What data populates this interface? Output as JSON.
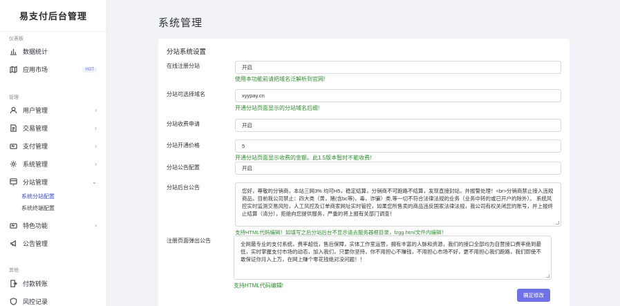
{
  "app": {
    "title": "易支付后台管理"
  },
  "sidebar": {
    "groups": [
      {
        "label": "仪表板"
      },
      {
        "label": "管理"
      },
      {
        "label": "其他"
      }
    ],
    "items": [
      {
        "label": "数据统计",
        "icon": "bar-chart-icon"
      },
      {
        "label": "应用市场",
        "icon": "map-icon",
        "badge": "HOT"
      },
      {
        "label": "用户管理",
        "icon": "user-icon"
      },
      {
        "label": "交易管理",
        "icon": "document-icon"
      },
      {
        "label": "支付管理",
        "icon": "payment-icon"
      },
      {
        "label": "系统管理",
        "icon": "gear-icon"
      },
      {
        "label": "分站管理",
        "icon": "substation-icon"
      },
      {
        "label": "特色功能",
        "icon": "feature-icon"
      },
      {
        "label": "公告管理",
        "icon": "megaphone-icon"
      },
      {
        "label": "付款转账",
        "icon": "transfer-icon"
      },
      {
        "label": "风控记录",
        "icon": "shield-icon"
      }
    ],
    "submenu": [
      {
        "label": "系统分站配置"
      },
      {
        "label": "系统终端配置"
      }
    ],
    "chevron": "›",
    "chevron_open": "⌄"
  },
  "page": {
    "title": "系统管理",
    "card_title": "分站系统设置",
    "rows": [
      {
        "label": "在线注册分站",
        "value": "开启",
        "hint": "使用本功能前请把域名泛解析到官网!"
      },
      {
        "label": "分站可选择域名",
        "value": "xyypay.cn",
        "hint": "开通分站页面显示的分站域名后缀!"
      },
      {
        "label": "分站收费申请",
        "value": "开启"
      },
      {
        "label": "分站开通价格",
        "value": "5",
        "hint": "开通分站页面显示收费的金额。此1.5版本暂时不能收费!"
      },
      {
        "label": "分站公告配置",
        "value": "开启"
      },
      {
        "label": "分站后台公告",
        "value": "您好，尊敬的分销商，本站三网3% 均可H5，稳定结算，分销商不可跑路不结算，发现直接封站，并报警处理！<br>分销商禁止接入违规商品，目前我公司禁止：四大类（黄，赌(含bc等)，毒，诈骗）类,等一切不符合法律法规的业务（业务中转的或已开户的除外）。 系统风控实时监测交易风险，人工风控及订单商家网址实时管控，如果您所售卖的商品违反国家法律法规，我公司有权关闭您的账号，并上报终止结算（清分），拒绝向您提供服务，严重的将上报有关部门调查！",
        "hint": "支持HTML代码编辑！如填写之后分站后台不显示请去服务器根目录，fzgg.html文件内编辑！"
      },
      {
        "label": "注册页面弹出公告",
        "value": "全网最专业的支付系统，费率超低，售后保障，实体工作室运营，拥有丰富的人脉和资源，我们的接口全部均为自营接口费率绝到最低，实时掌握支付市场的动态，加入我们，只要你坚持，你不用担心不赚钱，不用担心市场不好，更不用担心我们跑路，我们即使不敢保证你月入上万，在网上赚个零花钱绝对没问题！！",
        "hint": "支持HTML代码编辑!"
      }
    ],
    "submit_label": "确定修改"
  }
}
